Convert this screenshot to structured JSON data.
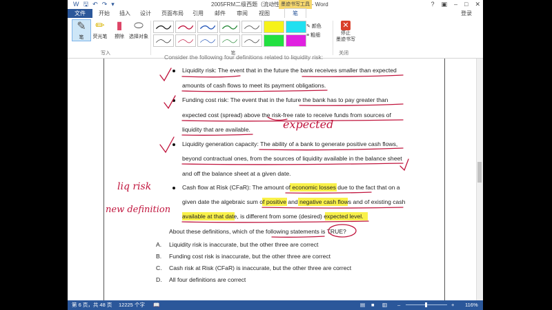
{
  "window": {
    "title": "2005FRM二级西题（流动性风险）_周琪 - Word",
    "context_tab_title": "墨迹书写工具",
    "qat_icons": [
      "word-icon",
      "save-icon",
      "undo-icon",
      "redo-icon",
      "customize-icon"
    ]
  },
  "tabs": {
    "file": "文件",
    "items": [
      "开始",
      "插入",
      "设计",
      "页面布局",
      "引用",
      "邮件",
      "审阅",
      "视图",
      "笔"
    ],
    "active": "笔",
    "login": "登录"
  },
  "ribbon": {
    "write_group": {
      "label": "写入",
      "buttons": [
        "笔",
        "荧光笔",
        "擦除",
        "选择对象"
      ]
    },
    "pens_group": {
      "label": "笔",
      "color_label": "颜色",
      "thickness_label": "粗细"
    },
    "close_group": {
      "label": "关闭",
      "stop_label_1": "停止",
      "stop_label_2": "墨迹书写"
    }
  },
  "document": {
    "lines": [
      "Consider the following four definitions related to liquidity risk:",
      "Liquidity risk: The event that in the future the bank receives smaller than expected",
      "amounts of cash flows to meet its payment obligations.",
      "Funding cost risk: The event that in the future the bank has to pay greater than",
      "expected cost (spread) above the risk-free rate to receive funds from sources of",
      "liquidity that are available.",
      "Liquidity generation capacity: The ability of a bank to generate positive cash flows,",
      "beyond contractual ones, from the sources of liquidity available in the balance sheet",
      "and off the balance sheet at a given date.",
      "Cash flow at Risk (CFaR): The amount of economic losses due to the fact that on a",
      "given date the algebraic sum of positive and negative cash flows and of existing cash",
      "available at that date, is different from some (desired) expected level.",
      "About these definitions, which of the following statements is TRUE?"
    ],
    "options": [
      {
        "letter": "A.",
        "text": "Liquidity risk is inaccurate, but the other three are correct"
      },
      {
        "letter": "B.",
        "text": "Funding cost risk is inaccurate, but the other three are correct"
      },
      {
        "letter": "C.",
        "text": "Cash risk at Risk (CFaR) is inaccurate, but the other three are correct"
      },
      {
        "letter": "D.",
        "text": "All four definitions are correct"
      }
    ],
    "handwritten": [
      "expected",
      "liq risk",
      "new definition"
    ],
    "highlight_color": "#f9f14a",
    "ink_color": "#c0143c"
  },
  "status": {
    "page": "第 6 页，共 48 页",
    "words": "12225 个字",
    "zoom": "116%"
  },
  "colors": {
    "accent": "#2b579a",
    "context_tab": "#f5d76e"
  }
}
